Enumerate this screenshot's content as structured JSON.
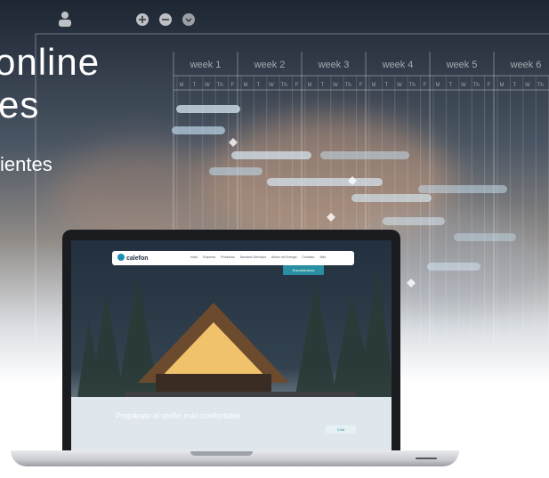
{
  "hero": {
    "title_line1": "online",
    "title_line2": "es",
    "subtitle": "ientes"
  },
  "gantt": {
    "weeks": [
      "week 1",
      "week 2",
      "week 3",
      "week 4",
      "week 5",
      "week 6"
    ],
    "day_letters": [
      "M",
      "T",
      "W",
      "Th",
      "F"
    ]
  },
  "website": {
    "logo": "calefon",
    "nav": [
      "Inicio",
      "Empresa",
      "Productos",
      "Nuestros Servicios",
      "Ahorro de Energía",
      "Contacto",
      "Más"
    ],
    "cta": "Encuéntranos",
    "headline": "Prepárate el otoño más confortable",
    "body": "",
    "chat": "Chat"
  }
}
